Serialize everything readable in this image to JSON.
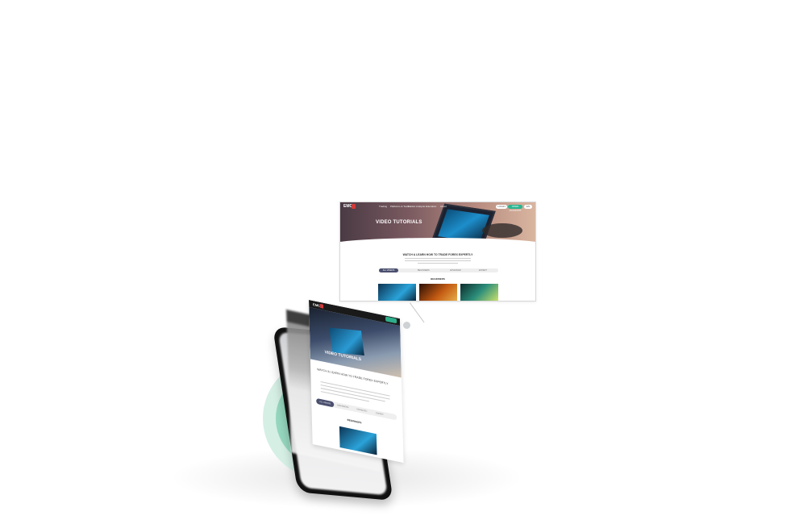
{
  "desktop": {
    "logo": "EMC",
    "nav": [
      "Trading",
      "Platforms & Tools",
      "Market Analysis",
      "Education",
      "About"
    ],
    "buttons": {
      "login": "LOGIN",
      "open": "OPEN ACCOUNT",
      "lang": "EN"
    },
    "hero_title": "VIDEO TUTORIALS",
    "headline": "WATCH & LEARN HOW TO TRADE FOREX EXPERTLY",
    "tabs": [
      "ALL VIDEOS",
      "BEGINNERS",
      "ADVANCED",
      "EXPERT"
    ],
    "section": "BEGINNERS"
  },
  "mobile": {
    "logo": "EMC",
    "hero_title": "VIDEO TUTORIALS",
    "headline": "WATCH & LEARN HOW TO TRADE FOREX EXPERTLY",
    "tabs": [
      "ALL VIDEOS",
      "BEGINNERS",
      "ADVANCED",
      "EXPERT"
    ],
    "section": "BEGINNERS"
  },
  "colors": {
    "accent_green": "#2fa882",
    "tab_active": "#4a4f6e",
    "brand_red": "#d23a3a"
  }
}
